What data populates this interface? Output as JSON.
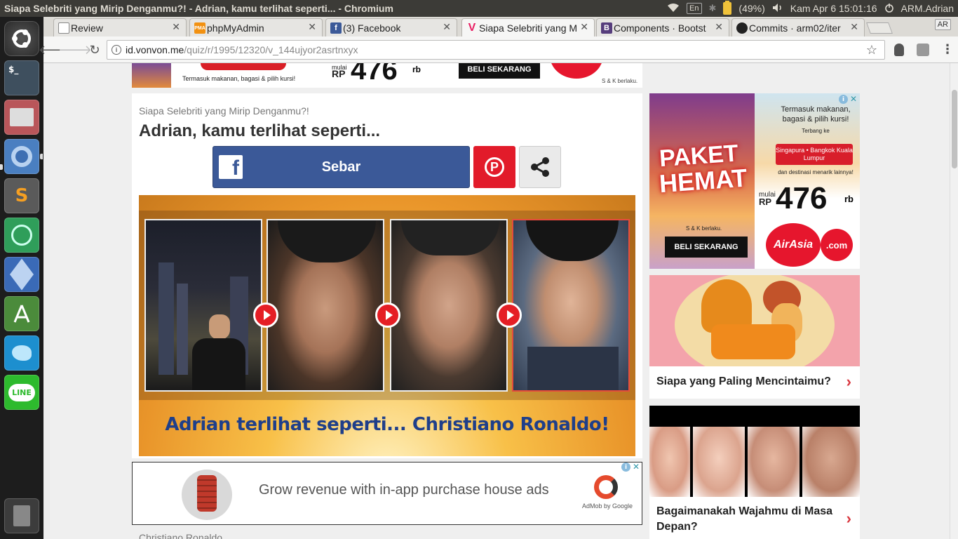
{
  "system": {
    "window_title": "Siapa Selebriti yang Mirip Denganmu?! - Adrian, kamu terlihat seperti... - Chromium",
    "keyboard": "En",
    "battery": "(49%)",
    "datetime": "Kam Apr  6 15:01:16",
    "user": "ARM.Adrian"
  },
  "tabs": [
    {
      "label": "Review",
      "icon": "doc-icon",
      "color": "#6b6b6b"
    },
    {
      "label": "phpMyAdmin",
      "icon": "pma-icon",
      "color": "#f29111"
    },
    {
      "label": "(3) Facebook",
      "icon": "facebook-icon",
      "color": "#3b5998"
    },
    {
      "label": "Siapa Selebriti yang M",
      "icon": "vonvon-icon",
      "color": "#e91e63"
    },
    {
      "label": "Components · Bootst",
      "icon": "bootstrap-icon",
      "color": "#563d7c"
    },
    {
      "label": "Commits · arm02/iter",
      "icon": "github-icon",
      "color": "#222222"
    }
  ],
  "profile_badge": "AR",
  "toolbar": {
    "url_host": "id.vonvon.me",
    "url_path": "/quiz/r/1995/12320/v_144ujyor2asrtnxyx"
  },
  "top_banner": {
    "small_text": "Termasuk makanan, bagasi & pilih kursi!",
    "mulai": "mulai",
    "rp": "RP",
    "price": "476",
    "rb": "rb",
    "buy": "BELI SEKARANG",
    "sk": "S & K berlaku."
  },
  "quiz": {
    "subtitle": "Siapa Selebriti yang Mirip Denganmu?!",
    "heading": "Adrian, kamu terlihat seperti...",
    "share_label": "Sebar",
    "caption": "Adrian terlihat seperti... Christiano Ronaldo!"
  },
  "bottom_ad": {
    "text": "Grow revenue with in-app purchase house ads",
    "brand": "AdMob by Google"
  },
  "below_text": "Christiano Ronaldo",
  "side_ad": {
    "paket": "PAKET",
    "hemat": "HEMAT",
    "incl": "Termasuk makanan, bagasi & pilih kursi!",
    "terbang": "Terbang ke",
    "destinations": "Singapura • Bangkok Kuala Lumpur",
    "more": "dan destinasi menarik lainnya!",
    "mulai": "mulai",
    "rp": "RP",
    "price": "476",
    "rb": "rb",
    "sk": "S & K berlaku.",
    "buy": "BELI SEKARANG",
    "brand": "AirAsia",
    "com": ".com"
  },
  "side_cards": [
    {
      "title": "Siapa yang Paling Mencintaimu?"
    },
    {
      "title": "Bagaimanakah Wajahmu di Masa Depan?"
    }
  ]
}
